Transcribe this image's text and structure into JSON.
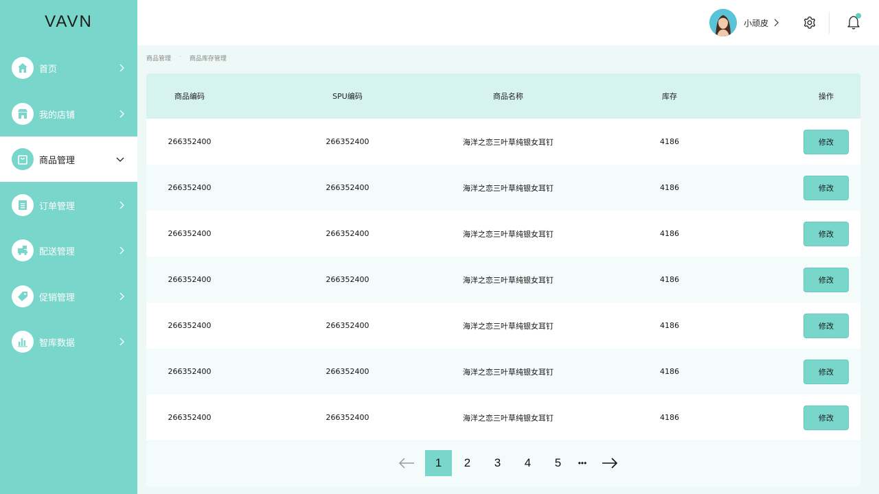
{
  "app": {
    "logo": "VAVN"
  },
  "sidebar": {
    "items": [
      {
        "label": "首页",
        "icon": "home-icon"
      },
      {
        "label": "我的店铺",
        "icon": "store-icon"
      },
      {
        "label": "商品管理",
        "icon": "bag-icon",
        "active": true
      },
      {
        "label": "订单管理",
        "icon": "order-list-icon"
      },
      {
        "label": "配送管理",
        "icon": "delivery-truck-icon"
      },
      {
        "label": "促销管理",
        "icon": "tag-icon"
      },
      {
        "label": "智库数据",
        "icon": "bar-chart-icon"
      }
    ]
  },
  "topbar": {
    "username": "小顽皮",
    "icons": [
      "gear-icon",
      "bell-icon"
    ]
  },
  "breadcrumb": [
    "商品管理",
    "商品库存管理"
  ],
  "table": {
    "headers": [
      "商品编码",
      "SPU编码",
      "商品名称",
      "库存",
      "操作"
    ],
    "rows": [
      {
        "code": "266352400",
        "spu": "266352400",
        "name": "海洋之恋三叶草纯银女耳钉",
        "stock": "4186",
        "action": "修改"
      },
      {
        "code": "266352400",
        "spu": "266352400",
        "name": "海洋之恋三叶草纯银女耳钉",
        "stock": "4186",
        "action": "修改"
      },
      {
        "code": "266352400",
        "spu": "266352400",
        "name": "海洋之恋三叶草纯银女耳钉",
        "stock": "4186",
        "action": "修改"
      },
      {
        "code": "266352400",
        "spu": "266352400",
        "name": "海洋之恋三叶草纯银女耳钉",
        "stock": "4186",
        "action": "修改"
      },
      {
        "code": "266352400",
        "spu": "266352400",
        "name": "海洋之恋三叶草纯银女耳钉",
        "stock": "4186",
        "action": "修改"
      },
      {
        "code": "266352400",
        "spu": "266352400",
        "name": "海洋之恋三叶草纯银女耳钉",
        "stock": "4186",
        "action": "修改"
      },
      {
        "code": "266352400",
        "spu": "266352400",
        "name": "海洋之恋三叶草纯银女耳钉",
        "stock": "4186",
        "action": "修改"
      }
    ]
  },
  "pagination": {
    "pages": [
      "1",
      "2",
      "3",
      "4",
      "5"
    ],
    "current": "1",
    "ellipsis": "•••"
  },
  "colors": {
    "accent": "#79d6cb",
    "header_row": "#d7f3f0",
    "page_bg": "#eef8f6"
  }
}
